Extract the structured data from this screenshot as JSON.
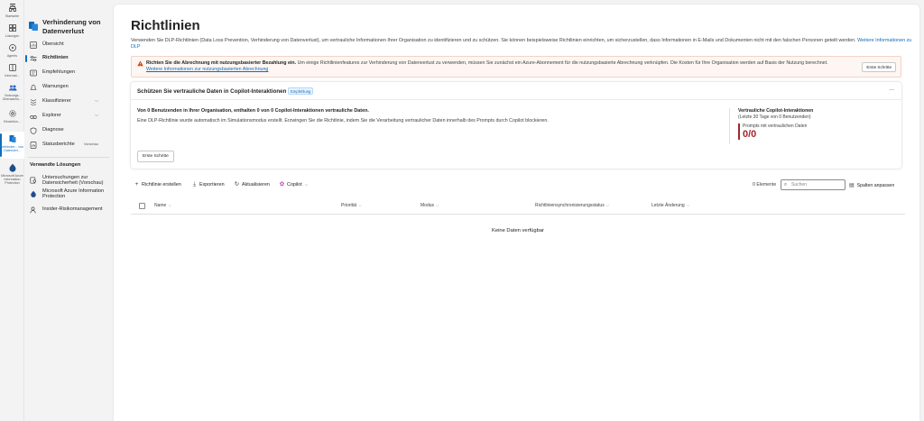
{
  "rail": {
    "items": [
      {
        "label": "Startseite",
        "icon": "home-icon"
      },
      {
        "label": "Lösungen",
        "icon": "grid-icon"
      },
      {
        "label": "Agents",
        "icon": "agent-icon"
      },
      {
        "label": "Informat...",
        "icon": "book-icon"
      },
      {
        "label": "Nutzungs-Überwachu...",
        "icon": "people-icon"
      },
      {
        "label": "Einstellun...",
        "icon": "gear-icon"
      },
      {
        "label": "Verhinder... von Datenverl...",
        "icon": "dlp-icon"
      },
      {
        "label": "Microsoft Azure Information Protection",
        "icon": "azure-ip-icon"
      }
    ]
  },
  "nav": {
    "title": "Verhinderung von Datenverlust",
    "items": [
      {
        "label": "Übersicht",
        "icon": "overview-icon"
      },
      {
        "label": "Richtlinien",
        "icon": "policy-icon"
      },
      {
        "label": "Empfehlungen",
        "icon": "recommend-icon"
      },
      {
        "label": "Warnungen",
        "icon": "alert-icon"
      },
      {
        "label": "Klassifizierer",
        "icon": "classifier-icon"
      },
      {
        "label": "Explorer",
        "icon": "explorer-icon"
      },
      {
        "label": "Diagnose",
        "icon": "diagnose-icon"
      },
      {
        "label": "Statusberichte",
        "icon": "report-icon",
        "preview": "Vorschau"
      }
    ],
    "related_title": "Verwandte Lösungen",
    "related": [
      {
        "label": "Untersuchungen zur Datensicherheit (Vorschau)",
        "icon": "investigation-icon"
      },
      {
        "label": "Microsoft Azure Information Protection",
        "icon": "azure-ip-icon"
      },
      {
        "label": "Insider-Risikomanagement",
        "icon": "insider-risk-icon"
      }
    ]
  },
  "main": {
    "title": "Richtlinien",
    "description": "Verwenden Sie DLP-Richtlinien (Data Loss Prevention, Verhinderung von Datenverlust), um vertrauliche Informationen Ihrer Organisation zu identifizieren und zu schützen. Sie können beispielsweise Richtlinien einrichten, um sicherzustellen, dass Informationen in E-Mails und Dokumenten nicht mit den falschen Personen geteilt werden.",
    "description_link": "Weitere Informationen zu DLP",
    "banner": {
      "bold": "Richten Sie die Abrechnung mit nutzungsbasierter Bezahlung ein.",
      "text": " Um einige Richtlinienfeatures zur Verhinderung von Datenverlust zu verwenden, müssen Sie zunächst ein Azure-Abonnement für die nutzungsbasierte Abrechnung verknüpfen. Die Kosten für Ihre Organisation werden auf Basis der Nutzung berechnet.",
      "link": "Weitere Informationen zur nutzungsbasierten Abrechnung",
      "button": "Erste Schritte"
    },
    "copilot": {
      "title": "Schützen Sie vertrauliche Daten in Copilot-Interaktionen",
      "badge": "Empfehlung",
      "more": "...",
      "summary": "Von 0 Benutzenden in Ihrer Organisation, enthalten 0 von 0 Copilot-Interaktionen vertrauliche Daten.",
      "body": "Eine DLP-Richtlinie wurde automatisch im Simulationsmodus erstellt. Erzwingen Sie die Richtlinie, indem Sie die Verarbeitung vertraulicher Daten innerhalb des Prompts durch Copilot blockieren.",
      "button": "Erste Schritte",
      "stats_title": "Vertrauliche Copilot-Interaktionen",
      "stats_sub": "(Letzte 30 Tage von 0 Benutzenden)",
      "metric_label": "Prompts mit vertraulichen Daten",
      "metric_value": "0/0",
      "accent": "#a4262c"
    },
    "toolbar": {
      "create": "Richtlinie erstellen",
      "export": "Exportieren",
      "refresh": "Aktualisieren",
      "copilot": "Copilot",
      "count": "0 Elemente",
      "search_placeholder": "Suchen",
      "columns": "Spalten anpassen"
    },
    "table": {
      "columns": [
        "Name",
        "Priorität",
        "Modus",
        "Richtliniensynchronisierungsstatus",
        "Letzte Änderung"
      ],
      "empty": "Keine Daten verfügbar"
    }
  }
}
